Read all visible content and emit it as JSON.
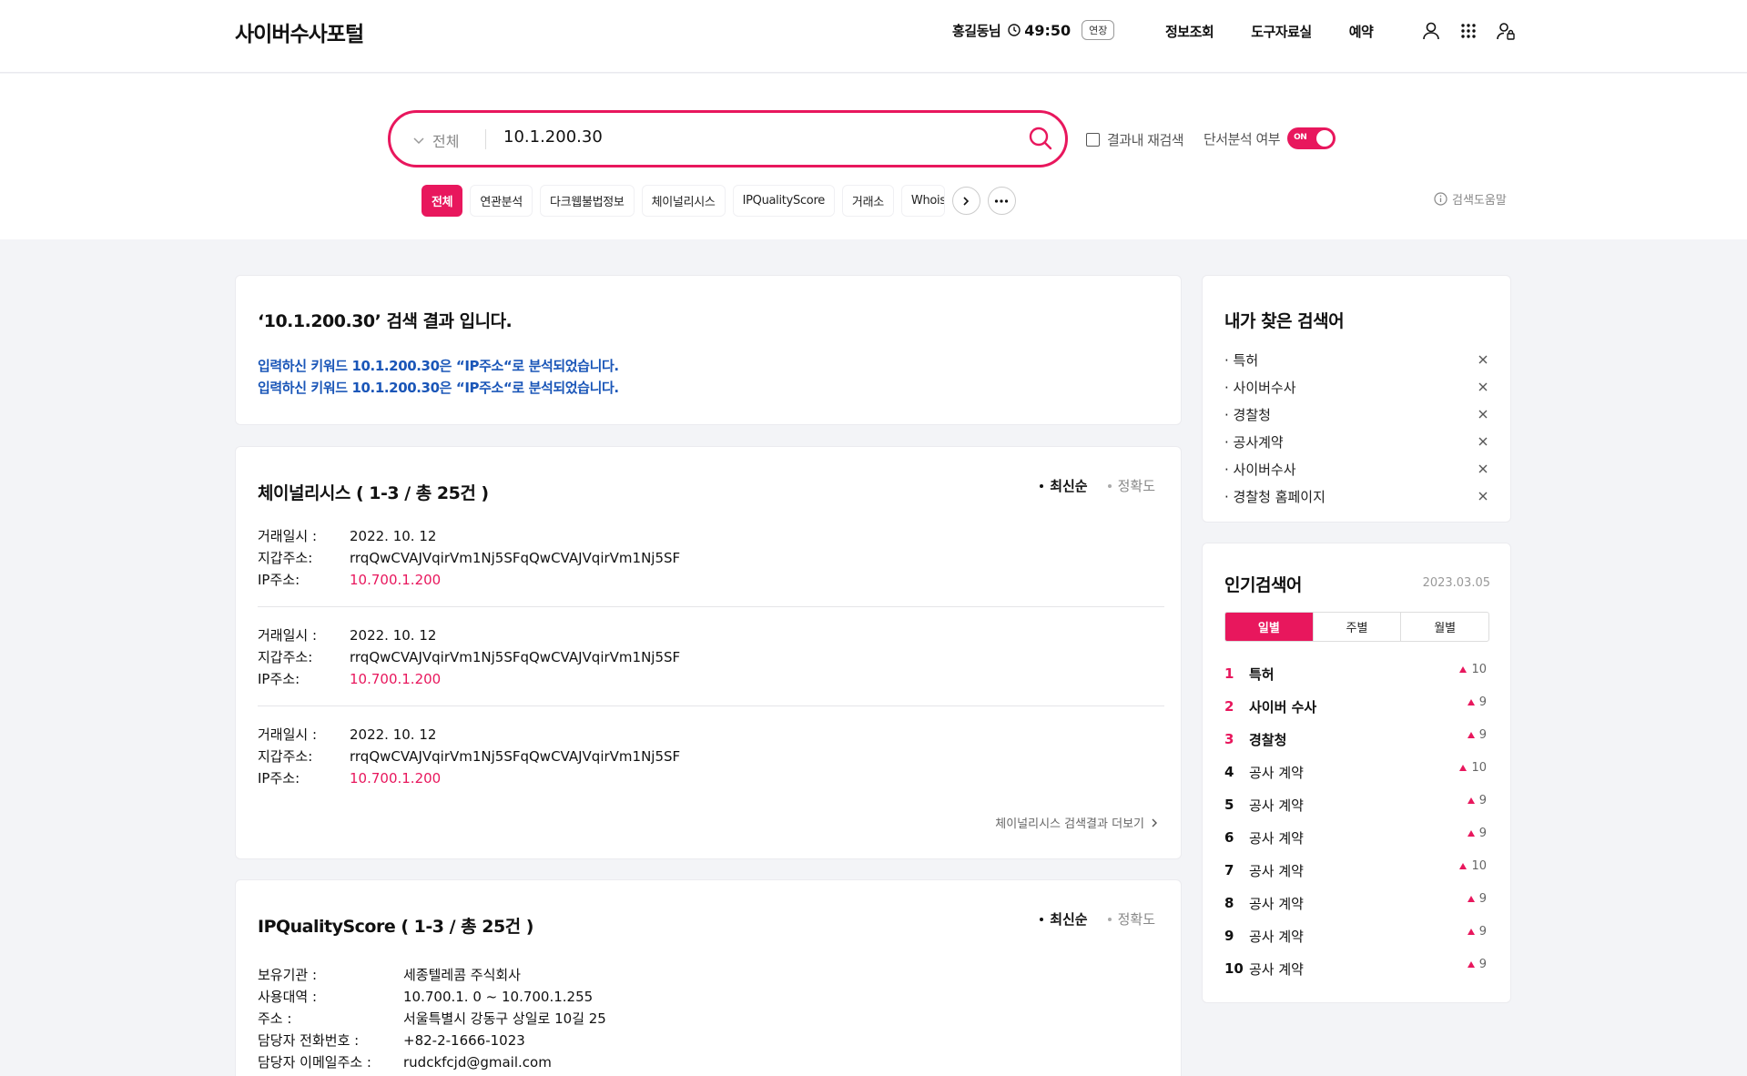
{
  "header": {
    "logo": "사이버수사포털",
    "user_name": "홍길동님",
    "timer": "49:50",
    "extend_label": "연장",
    "nav": [
      "정보조회",
      "도구자료실",
      "예약"
    ]
  },
  "search": {
    "scope": "전체",
    "query": "10.1.200.30",
    "research_label": "결과내 재검색",
    "fragment_label": "단서분석 여부",
    "toggle_label": "ON",
    "chips": [
      "전체",
      "연관분석",
      "다크웹불법정보",
      "체이널리시스",
      "IPQualityScore",
      "거래소",
      "Whois"
    ],
    "help_label": "검색도움말"
  },
  "summary": {
    "title": "‘10.1.200.30’ 검색 결과 입니다.",
    "lines": [
      "입력하신 키워드 10.1.200.30은  “IP주소“로 분석되었습니다.",
      "입력하신 키워드 10.1.200.30은  “IP주소“로 분석되었습니다."
    ]
  },
  "chainalysis": {
    "title": "체이널리시스 ( 1-3 / 총 25건 )",
    "sort_latest": "최신순",
    "sort_accuracy": "정확도",
    "labels": {
      "date": "거래일시 :",
      "wallet": "지갑주소:",
      "ip": "IP주소:"
    },
    "records": [
      {
        "date": "2022. 10. 12",
        "wallet": "rrqQwCVAJVqirVm1Nj5SFqQwCVAJVqirVm1Nj5SF",
        "ip": "10.700.1.200"
      },
      {
        "date": "2022. 10. 12",
        "wallet": "rrqQwCVAJVqirVm1Nj5SFqQwCVAJVqirVm1Nj5SF",
        "ip": "10.700.1.200"
      },
      {
        "date": "2022. 10. 12",
        "wallet": "rrqQwCVAJVqirVm1Nj5SFqQwCVAJVqirVm1Nj5SF",
        "ip": "10.700.1.200"
      }
    ],
    "more_label": "체이널리시스 검색결과 더보기"
  },
  "ipqs": {
    "title": "IPQualityScore ( 1-3 / 총 25건 )",
    "sort_latest": "최신순",
    "sort_accuracy": "정확도",
    "rows": [
      {
        "k": "보유기관 :",
        "v": "세종텔레콤 주식회사"
      },
      {
        "k": "사용대역 :",
        "v": "10.700.1. 0 ~ 10.700.1.255"
      },
      {
        "k": "주소 :",
        "v": "서울특별시 강동구 상일로 10길 25"
      },
      {
        "k": "담당자 전화번호 :",
        "v": "+82-2-1666-1023"
      },
      {
        "k": "담당자 이메일주소 :",
        "v": "rudckfcjd@gmail.com"
      }
    ]
  },
  "recent": {
    "title": "내가 찾은 검색어",
    "items": [
      "· 특허",
      "· 사이버수사",
      "· 경찰청",
      "· 공사계약",
      "· 사이버수사",
      "· 경찰청 홈페이지"
    ]
  },
  "popular": {
    "title": "인기검색어",
    "date": "2023.03.05",
    "tabs": [
      "일별",
      "주별",
      "월별"
    ],
    "items": [
      {
        "rank": "1",
        "kw": "특허",
        "count": "10"
      },
      {
        "rank": "2",
        "kw": "사이버 수사",
        "count": "9"
      },
      {
        "rank": "3",
        "kw": "경찰청",
        "count": "9"
      },
      {
        "rank": "4",
        "kw": "공사 계약",
        "count": "10"
      },
      {
        "rank": "5",
        "kw": "공사 계약",
        "count": "9"
      },
      {
        "rank": "6",
        "kw": "공사 계약",
        "count": "9"
      },
      {
        "rank": "7",
        "kw": "공사 계약",
        "count": "10"
      },
      {
        "rank": "8",
        "kw": "공사 계약",
        "count": "9"
      },
      {
        "rank": "9",
        "kw": "공사 계약",
        "count": "9"
      },
      {
        "rank": "10",
        "kw": "공사 계약",
        "count": "9"
      }
    ]
  },
  "colors": {
    "accent": "#e8175d",
    "link_blue": "#1a56b8"
  }
}
